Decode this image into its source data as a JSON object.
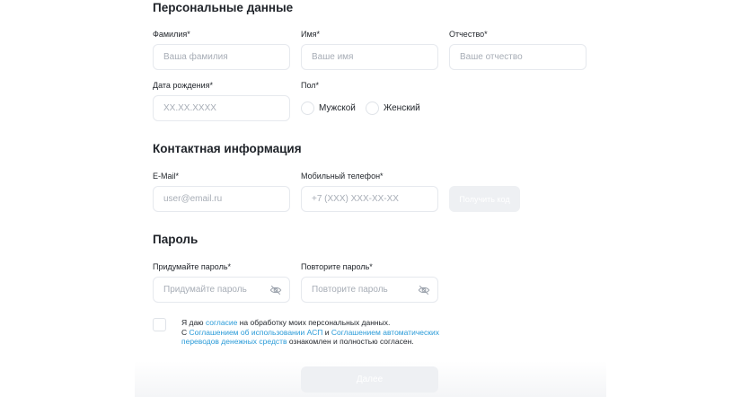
{
  "personal": {
    "title": "Персональные данные",
    "lastname_label": "Фамилия*",
    "lastname_placeholder": "Ваша фамилия",
    "firstname_label": "Имя*",
    "firstname_placeholder": "Ваше имя",
    "patronymic_label": "Отчество*",
    "patronymic_placeholder": "Ваше отчество",
    "birthdate_label": "Дата рождения*",
    "birthdate_placeholder": "XX.XX.XXXX",
    "gender_label": "Пол*",
    "gender_male": "Мужской",
    "gender_female": "Женский"
  },
  "contact": {
    "title": "Контактная информация",
    "email_label": "E-Mail*",
    "email_placeholder": "user@email.ru",
    "phone_label": "Мобильный телефон*",
    "phone_placeholder": "+7 (XXX) XXX-XX-XX",
    "get_code_label": "Получить код"
  },
  "password": {
    "title": "Пароль",
    "new_label": "Придумайте пароль*",
    "new_placeholder": "Придумайте пароль",
    "repeat_label": "Повторите пароль*",
    "repeat_placeholder": "Повторите пароль"
  },
  "consent": {
    "part1": "Я даю ",
    "link1": "согласие",
    "part2": " на обработку моих персональных данных.",
    "part3": "С ",
    "link2": "Соглашением об использовании АСП",
    "part4": " и ",
    "link3": "Соглашением автоматических переводов денежных средств",
    "part5": " ознакомлен и полностью согласен."
  },
  "footer": {
    "next_label": "Далее"
  },
  "icons": {
    "password_toggle": "eye-off-icon"
  },
  "colors": {
    "link": "#2a9bd8",
    "disabled_button": "#eef0f3",
    "border": "#e6e9ee"
  }
}
